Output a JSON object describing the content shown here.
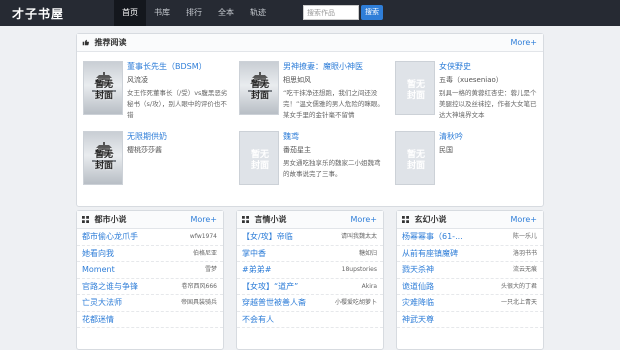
{
  "header": {
    "brand": "才子书屋",
    "nav": [
      "首页",
      "书库",
      "排行",
      "全本",
      "轨迹"
    ],
    "search_placeholder": "搜索作品",
    "search_button": "搜索"
  },
  "recommend": {
    "title": "推荐阅读",
    "more": "More+",
    "books": [
      {
        "title": "董事长先生（BDSM）",
        "author": "风流凌",
        "desc": "女王作死董事长（/受）vs腹黑恶劣秘书（s/攻），别人眼中的评价也不错",
        "cover": "photo"
      },
      {
        "title": "男神撩妻：魔眼小神医",
        "author": "相思如风",
        "desc": "“吃干抹净还想跑，我们之间还没完！”温文儒雅的男人危险的眯眼。某女手里的金针毫不留情",
        "cover": "photo"
      },
      {
        "title": "女侠野史",
        "author": "五毒（xueseniao）",
        "desc": "别具一格的黄蓉红杏史：蓉儿是个美腿控以及丝袜控，作者大女笔已达大神境界文本",
        "cover": "placeholder"
      },
      {
        "title": "无限期供奶",
        "author": "樱桃莎莎酱",
        "desc": "",
        "cover": "photo"
      },
      {
        "title": "魏鸢",
        "author": "番茄星主",
        "desc": "男女通吃独享乐的魏家二小姐魏鸢的故事说完了三事。",
        "cover": "placeholder"
      },
      {
        "title": "清秋吟",
        "author": "民国",
        "desc": "",
        "cover": "placeholder"
      }
    ],
    "placeholder_cover_text": [
      "暂无",
      "封面"
    ],
    "photo_cover_text": [
      "暂无",
      "封面"
    ]
  },
  "lists": [
    {
      "title": "都市小说",
      "more": "More+",
      "rows": [
        {
          "title": "都市偷心龙爪手",
          "author": "wfw1974"
        },
        {
          "title": "她看向我",
          "author": "伯格尼亚"
        },
        {
          "title": "Moment",
          "author": "雪梦"
        },
        {
          "title": "官路之谁与争锋",
          "author": "卷帘西风666"
        },
        {
          "title": "亡灵大法师",
          "author": "帝国具装骑兵"
        },
        {
          "title": "花都迷情",
          "author": ""
        }
      ]
    },
    {
      "title": "言情小说",
      "more": "More+",
      "rows": [
        {
          "title": "【女/攻】帝临",
          "author": "请叫我魏太太"
        },
        {
          "title": "掌中香",
          "author": "糖如归"
        },
        {
          "title": "#弟弟#",
          "author": "18upstories"
        },
        {
          "title": "【女攻】“道产”",
          "author": "Akira"
        },
        {
          "title": "穿越普世被善人斋",
          "author": "小樱爱吃胡萝卜"
        },
        {
          "title": "不会有人",
          "author": ""
        }
      ]
    },
    {
      "title": "玄幻小说",
      "more": "More+",
      "rows": [
        {
          "title": "杨幂幂事（61-...",
          "author": "陈一乐儿"
        },
        {
          "title": "从前有座镇魔碑",
          "author": "洛羽书书"
        },
        {
          "title": "戮天杀神",
          "author": "流云无痕"
        },
        {
          "title": "诡道仙路",
          "author": "头很大的丁君"
        },
        {
          "title": "灾难降临",
          "author": "一只北上青天"
        },
        {
          "title": "神武天尊",
          "author": ""
        }
      ]
    }
  ],
  "colors": {
    "topbar": "#262a33",
    "link": "#2f7ed8",
    "accent": "#2f7ed8"
  }
}
